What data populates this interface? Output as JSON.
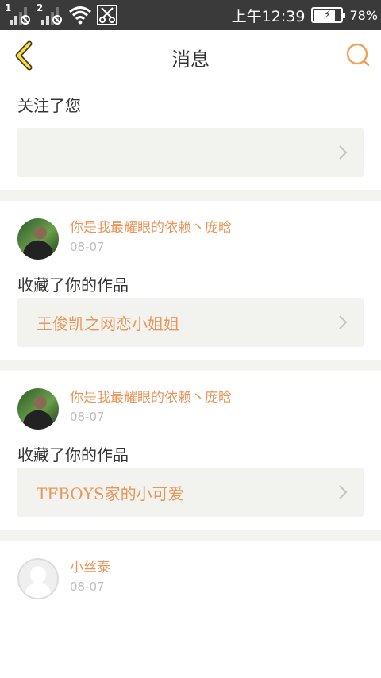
{
  "statusbar": {
    "sim1_label": "1",
    "sim2_label": "2",
    "time": "上午12:39",
    "battery_percent": "78%",
    "battery_level": 0.78,
    "icons": [
      "signal-sim1-icon",
      "signal-sim2-icon",
      "wifi-icon",
      "scissors-icon",
      "battery-icon"
    ]
  },
  "header": {
    "title": "消息",
    "accent_color": "#e8955a"
  },
  "notifications": [
    {
      "show_user": false,
      "action": "关注了您",
      "work_title": ""
    },
    {
      "show_user": true,
      "avatar": "photo",
      "user_name": "你是我最耀眼的依赖丶庞晗",
      "date": "08-07",
      "action": "收藏了你的作品",
      "work_title": "王俊凯之网恋小姐姐"
    },
    {
      "show_user": true,
      "avatar": "photo",
      "user_name": "你是我最耀眼的依赖丶庞晗",
      "date": "08-07",
      "action": "收藏了你的作品",
      "work_title": "TFBOYS家的小可爱"
    },
    {
      "show_user": true,
      "avatar": "default",
      "user_name": "小丝泰",
      "date": "08-07"
    }
  ]
}
